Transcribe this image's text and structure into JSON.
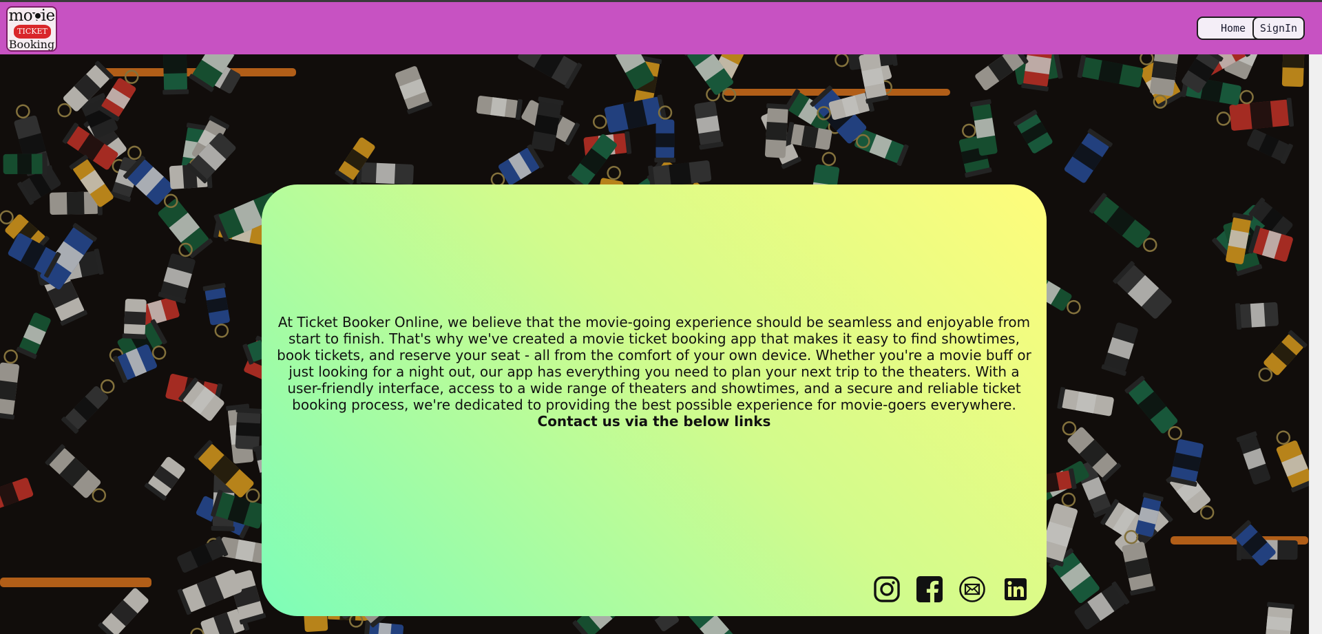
{
  "navbar": {
    "logo": {
      "line1": "movie",
      "ticket": "TICKET",
      "line2": "Booking"
    },
    "home_label": "Home",
    "signin_label": "SignIn",
    "background_color": "#c752c2"
  },
  "hero": {
    "background": "collage of photographic film canisters"
  },
  "about_card": {
    "body": "At Ticket Booker Online, we believe that the movie-going experience should be seamless and enjoyable from start to finish. That's why we've created a movie ticket booking app that makes it easy to find showtimes, book tickets, and reserve your seat - all from the comfort of your own device. Whether you're a movie buff or just looking for a night out, our app has everything you need to plan your next trip to the theaters. With a user-friendly interface, access to a wide range of theaters and showtimes, and a secure and reliable ticket booking process, we're dedicated to providing the best possible experience for movie-goers everywhere.",
    "cta": "Contact us via the below links",
    "gradient": [
      "#fffc7b",
      "#d2fb8c",
      "#7dfdb8"
    ]
  },
  "social_links": [
    {
      "icon": "instagram-icon"
    },
    {
      "icon": "facebook-icon"
    },
    {
      "icon": "mail-icon"
    },
    {
      "icon": "linkedin-icon"
    }
  ]
}
